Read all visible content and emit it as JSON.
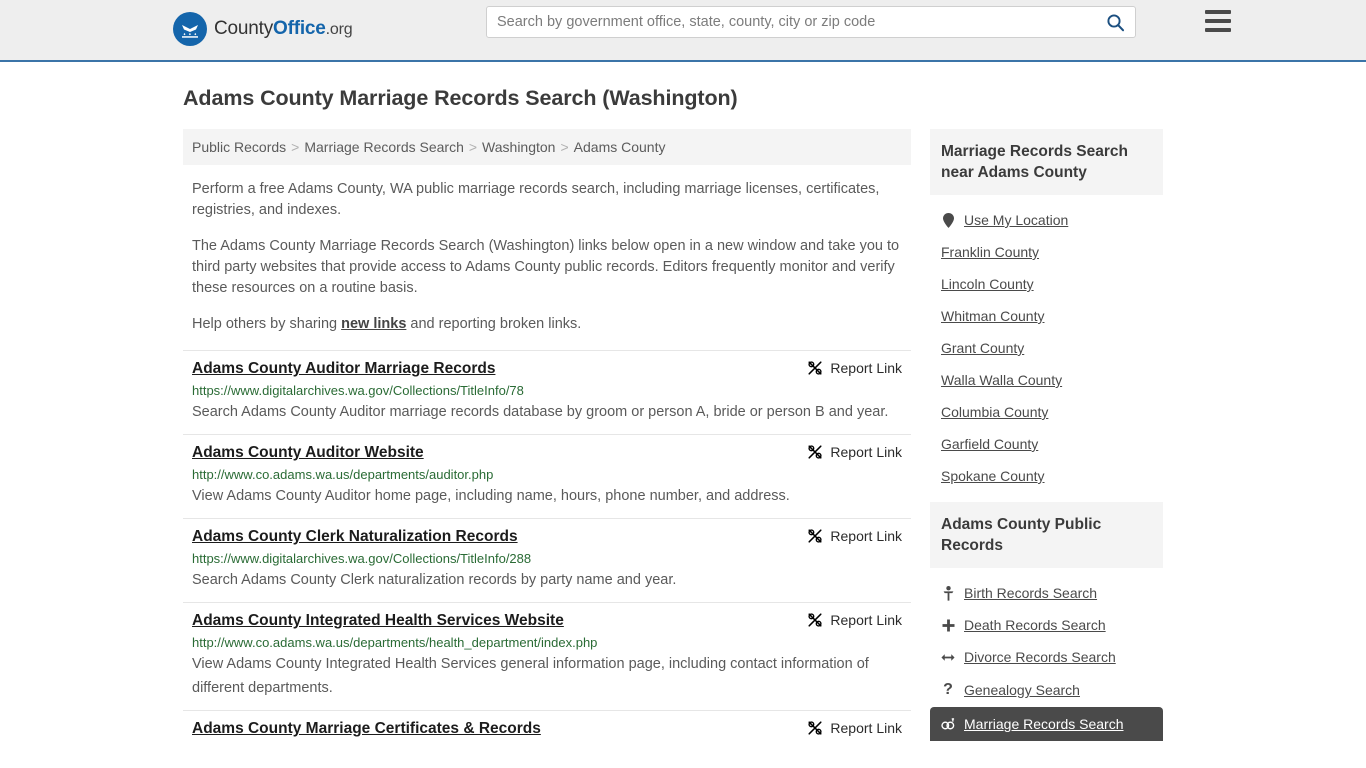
{
  "header": {
    "logo_primary": "County",
    "logo_accent": "Office",
    "logo_suffix": ".org",
    "search_placeholder": "Search by government office, state, county, city or zip code",
    "search_value": "",
    "search_icon": "search-icon",
    "menu_icon": "hamburger-menu-icon",
    "accent_color": "#1465ab"
  },
  "page": {
    "title": "Adams County Marriage Records Search (Washington)"
  },
  "breadcrumb": {
    "separator": ">",
    "items": [
      {
        "label": "Public Records"
      },
      {
        "label": "Marriage Records Search"
      },
      {
        "label": "Washington"
      },
      {
        "label": "Adams County"
      }
    ]
  },
  "intro": {
    "p1": "Perform a free Adams County, WA public marriage records search, including marriage licenses, certificates, registries, and indexes.",
    "p2": "The Adams County Marriage Records Search (Washington) links below open in a new window and take you to third party websites that provide access to Adams County public records. Editors frequently monitor and verify these resources on a routine basis.",
    "p3_before": "Help others by sharing ",
    "p3_link": "new links",
    "p3_after": " and reporting broken links."
  },
  "results": {
    "report_label": "Report Link",
    "report_icon": "broken-link-icon",
    "items": [
      {
        "title": "Adams County Auditor Marriage Records",
        "url": "https://www.digitalarchives.wa.gov/Collections/TitleInfo/78",
        "description": "Search Adams County Auditor marriage records database by groom or person A, bride or person B and year."
      },
      {
        "title": "Adams County Auditor Website",
        "url": "http://www.co.adams.wa.us/departments/auditor.php",
        "description": "View Adams County Auditor home page, including name, hours, phone number, and address."
      },
      {
        "title": "Adams County Clerk Naturalization Records",
        "url": "https://www.digitalarchives.wa.gov/Collections/TitleInfo/288",
        "description": "Search Adams County Clerk naturalization records by party name and year."
      },
      {
        "title": "Adams County Integrated Health Services Website",
        "url": "http://www.co.adams.wa.us/departments/health_department/index.php",
        "description": "View Adams County Integrated Health Services general information page, including contact information of different departments."
      },
      {
        "title": "Adams County Marriage Certificates & Records",
        "url": "",
        "description": ""
      }
    ]
  },
  "sidebar": {
    "nearby": {
      "heading": "Marriage Records Search near Adams County",
      "items": [
        {
          "label": "Use My Location",
          "icon": "map-pin-icon"
        },
        {
          "label": "Franklin County",
          "icon": ""
        },
        {
          "label": "Lincoln County",
          "icon": ""
        },
        {
          "label": "Whitman County",
          "icon": ""
        },
        {
          "label": "Grant County",
          "icon": ""
        },
        {
          "label": "Walla Walla County",
          "icon": ""
        },
        {
          "label": "Columbia County",
          "icon": ""
        },
        {
          "label": "Garfield County",
          "icon": ""
        },
        {
          "label": "Spokane County",
          "icon": ""
        }
      ]
    },
    "public_records": {
      "heading": "Adams County Public Records",
      "active_background": "#4a4a4a",
      "items": [
        {
          "label": "Birth Records Search",
          "icon": "baby-icon",
          "glyph": "Ɣ",
          "active": false
        },
        {
          "label": "Death Records Search",
          "icon": "cross-icon",
          "glyph": "✚",
          "active": false
        },
        {
          "label": "Divorce Records Search",
          "icon": "left-right-arrow-icon",
          "glyph": "↔",
          "active": false
        },
        {
          "label": "Genealogy Search",
          "icon": "question-mark-icon",
          "glyph": "?",
          "active": false
        },
        {
          "label": "Marriage Records Search",
          "icon": "rings-icon",
          "glyph": "⚭",
          "active": true
        }
      ]
    }
  }
}
